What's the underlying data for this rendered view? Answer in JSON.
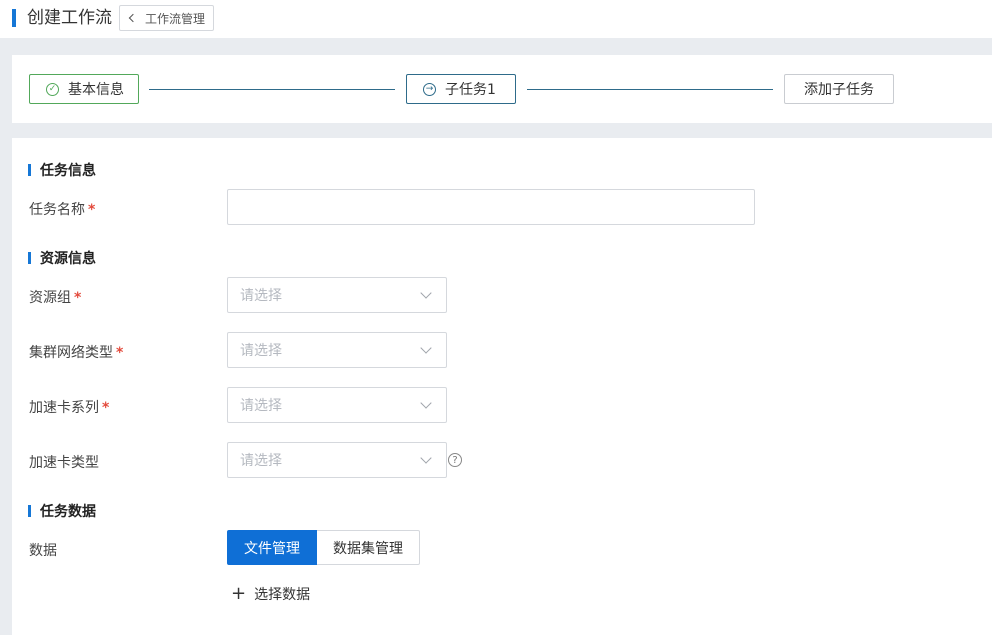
{
  "header": {
    "title": "创建工作流",
    "back_label": "工作流管理"
  },
  "steps": {
    "done_label": "基本信息",
    "active_label": "子任务1",
    "add_label": "添加子任务"
  },
  "sections": {
    "task_info": "任务信息",
    "resource_info": "资源信息",
    "task_data": "任务数据"
  },
  "fields": {
    "task_name": {
      "label": "任务名称",
      "value": "",
      "required": "*"
    },
    "resource_group": {
      "label": "资源组",
      "placeholder": "请选择",
      "required": "*"
    },
    "network_type": {
      "label": "集群网络类型",
      "placeholder": "请选择",
      "required": "*"
    },
    "accel_series": {
      "label": "加速卡系列",
      "placeholder": "请选择",
      "required": "*"
    },
    "accel_type": {
      "label": "加速卡类型",
      "placeholder": "请选择",
      "help": "?"
    },
    "data": {
      "label": "数据"
    }
  },
  "data_tabs": {
    "file_mgmt": "文件管理",
    "dataset_mgmt": "数据集管理"
  },
  "add_data_label": "选择数据",
  "colors": {
    "accent": "#1677d6",
    "success": "#52a85a",
    "primary_button": "#0f6fd6",
    "required": "#e34b3d"
  }
}
